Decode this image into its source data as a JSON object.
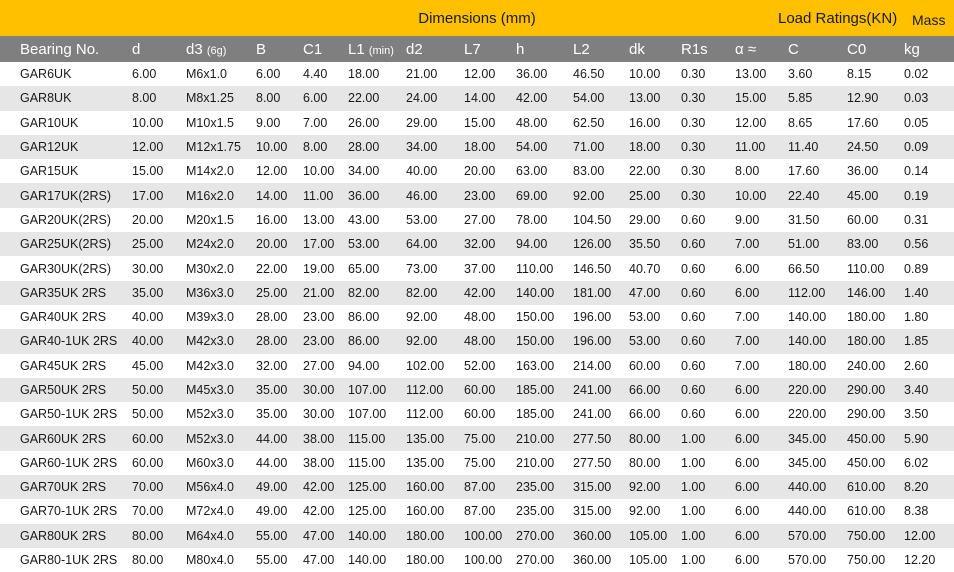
{
  "banner": {
    "dimensions": "Dimensions (mm)",
    "load_ratings": "Load Ratings(KN)",
    "mass": "Mass"
  },
  "columns": [
    {
      "label": "Bearing No.",
      "sub": ""
    },
    {
      "label": "d",
      "sub": ""
    },
    {
      "label": "d3",
      "sub": "(6g)"
    },
    {
      "label": "B",
      "sub": ""
    },
    {
      "label": "C1",
      "sub": ""
    },
    {
      "label": "L1",
      "sub": "(min)"
    },
    {
      "label": "d2",
      "sub": ""
    },
    {
      "label": "L7",
      "sub": ""
    },
    {
      "label": "h",
      "sub": ""
    },
    {
      "label": "L2",
      "sub": ""
    },
    {
      "label": "dk",
      "sub": ""
    },
    {
      "label": "R1s",
      "sub": ""
    },
    {
      "label": "α ≈",
      "sub": ""
    },
    {
      "label": "C",
      "sub": ""
    },
    {
      "label": "C0",
      "sub": ""
    },
    {
      "label": "kg",
      "sub": ""
    }
  ],
  "rows": [
    [
      "GAR6UK",
      "6.00",
      "M6x1.0",
      "6.00",
      "4.40",
      "18.00",
      "21.00",
      "12.00",
      "36.00",
      "46.50",
      "10.00",
      "0.30",
      "13.00",
      "3.60",
      "8.15",
      "0.02"
    ],
    [
      "GAR8UK",
      "8.00",
      "M8x1.25",
      "8.00",
      "6.00",
      "22.00",
      "24.00",
      "14.00",
      "42.00",
      "54.00",
      "13.00",
      "0.30",
      "15.00",
      "5.85",
      "12.90",
      "0.03"
    ],
    [
      "GAR10UK",
      "10.00",
      "M10x1.5",
      "9.00",
      "7.00",
      "26.00",
      "29.00",
      "15.00",
      "48.00",
      "62.50",
      "16.00",
      "0.30",
      "12.00",
      "8.65",
      "17.60",
      "0.05"
    ],
    [
      "GAR12UK",
      "12.00",
      "M12x1.75",
      "10.00",
      "8.00",
      "28.00",
      "34.00",
      "18.00",
      "54.00",
      "71.00",
      "18.00",
      "0.30",
      "11.00",
      "11.40",
      "24.50",
      "0.09"
    ],
    [
      "GAR15UK",
      "15.00",
      "M14x2.0",
      "12.00",
      "10.00",
      "34.00",
      "40.00",
      "20.00",
      "63.00",
      "83.00",
      "22.00",
      "0.30",
      "8.00",
      "17.60",
      "36.00",
      "0.14"
    ],
    [
      "GAR17UK(2RS)",
      "17.00",
      "M16x2.0",
      "14.00",
      "11.00",
      "36.00",
      "46.00",
      "23.00",
      "69.00",
      "92.00",
      "25.00",
      "0.30",
      "10.00",
      "22.40",
      "45.00",
      "0.19"
    ],
    [
      "GAR20UK(2RS)",
      "20.00",
      "M20x1.5",
      "16.00",
      "13.00",
      "43.00",
      "53.00",
      "27.00",
      "78.00",
      "104.50",
      "29.00",
      "0.60",
      "9.00",
      "31.50",
      "60.00",
      "0.31"
    ],
    [
      "GAR25UK(2RS)",
      "25.00",
      "M24x2.0",
      "20.00",
      "17.00",
      "53.00",
      "64.00",
      "32.00",
      "94.00",
      "126.00",
      "35.50",
      "0.60",
      "7.00",
      "51.00",
      "83.00",
      "0.56"
    ],
    [
      "GAR30UK(2RS)",
      "30.00",
      "M30x2.0",
      "22.00",
      "19.00",
      "65.00",
      "73.00",
      "37.00",
      "110.00",
      "146.50",
      "40.70",
      "0.60",
      "6.00",
      "66.50",
      "110.00",
      "0.89"
    ],
    [
      "GAR35UK 2RS",
      "35.00",
      "M36x3.0",
      "25.00",
      "21.00",
      "82.00",
      "82.00",
      "42.00",
      "140.00",
      "181.00",
      "47.00",
      "0.60",
      "6.00",
      "112.00",
      "146.00",
      "1.40"
    ],
    [
      "GAR40UK 2RS",
      "40.00",
      "M39x3.0",
      "28.00",
      "23.00",
      "86.00",
      "92.00",
      "48.00",
      "150.00",
      "196.00",
      "53.00",
      "0.60",
      "7.00",
      "140.00",
      "180.00",
      "1.80"
    ],
    [
      "GAR40-1UK 2RS",
      "40.00",
      "M42x3.0",
      "28.00",
      "23.00",
      "86.00",
      "92.00",
      "48.00",
      "150.00",
      "196.00",
      "53.00",
      "0.60",
      "7.00",
      "140.00",
      "180.00",
      "1.85"
    ],
    [
      "GAR45UK 2RS",
      "45.00",
      "M42x3.0",
      "32.00",
      "27.00",
      "94.00",
      "102.00",
      "52.00",
      "163.00",
      "214.00",
      "60.00",
      "0.60",
      "7.00",
      "180.00",
      "240.00",
      "2.60"
    ],
    [
      "GAR50UK 2RS",
      "50.00",
      "M45x3.0",
      "35.00",
      "30.00",
      "107.00",
      "112.00",
      "60.00",
      "185.00",
      "241.00",
      "66.00",
      "0.60",
      "6.00",
      "220.00",
      "290.00",
      "3.40"
    ],
    [
      "GAR50-1UK 2RS",
      "50.00",
      "M52x3.0",
      "35.00",
      "30.00",
      "107.00",
      "112.00",
      "60.00",
      "185.00",
      "241.00",
      "66.00",
      "0.60",
      "6.00",
      "220.00",
      "290.00",
      "3.50"
    ],
    [
      "GAR60UK 2RS",
      "60.00",
      "M52x3.0",
      "44.00",
      "38.00",
      "115.00",
      "135.00",
      "75.00",
      "210.00",
      "277.50",
      "80.00",
      "1.00",
      "6.00",
      "345.00",
      "450.00",
      "5.90"
    ],
    [
      "GAR60-1UK 2RS",
      "60.00",
      "M60x3.0",
      "44.00",
      "38.00",
      "115.00",
      "135.00",
      "75.00",
      "210.00",
      "277.50",
      "80.00",
      "1.00",
      "6.00",
      "345.00",
      "450.00",
      "6.02"
    ],
    [
      "GAR70UK 2RS",
      "70.00",
      "M56x4.0",
      "49.00",
      "42.00",
      "125.00",
      "160.00",
      "87.00",
      "235.00",
      "315.00",
      "92.00",
      "1.00",
      "6.00",
      "440.00",
      "610.00",
      "8.20"
    ],
    [
      "GAR70-1UK 2RS",
      "70.00",
      "M72x4.0",
      "49.00",
      "42.00",
      "125.00",
      "160.00",
      "87.00",
      "235.00",
      "315.00",
      "92.00",
      "1.00",
      "6.00",
      "440.00",
      "610.00",
      "8.38"
    ],
    [
      "GAR80UK 2RS",
      "80.00",
      "M64x4.0",
      "55.00",
      "47.00",
      "140.00",
      "180.00",
      "100.00",
      "270.00",
      "360.00",
      "105.00",
      "1.00",
      "6.00",
      "570.00",
      "750.00",
      "12.00"
    ],
    [
      "GAR80-1UK 2RS",
      "80.00",
      "M80x4.0",
      "55.00",
      "47.00",
      "140.00",
      "180.00",
      "100.00",
      "270.00",
      "360.00",
      "105.00",
      "1.00",
      "6.00",
      "570.00",
      "750.00",
      "12.20"
    ]
  ]
}
